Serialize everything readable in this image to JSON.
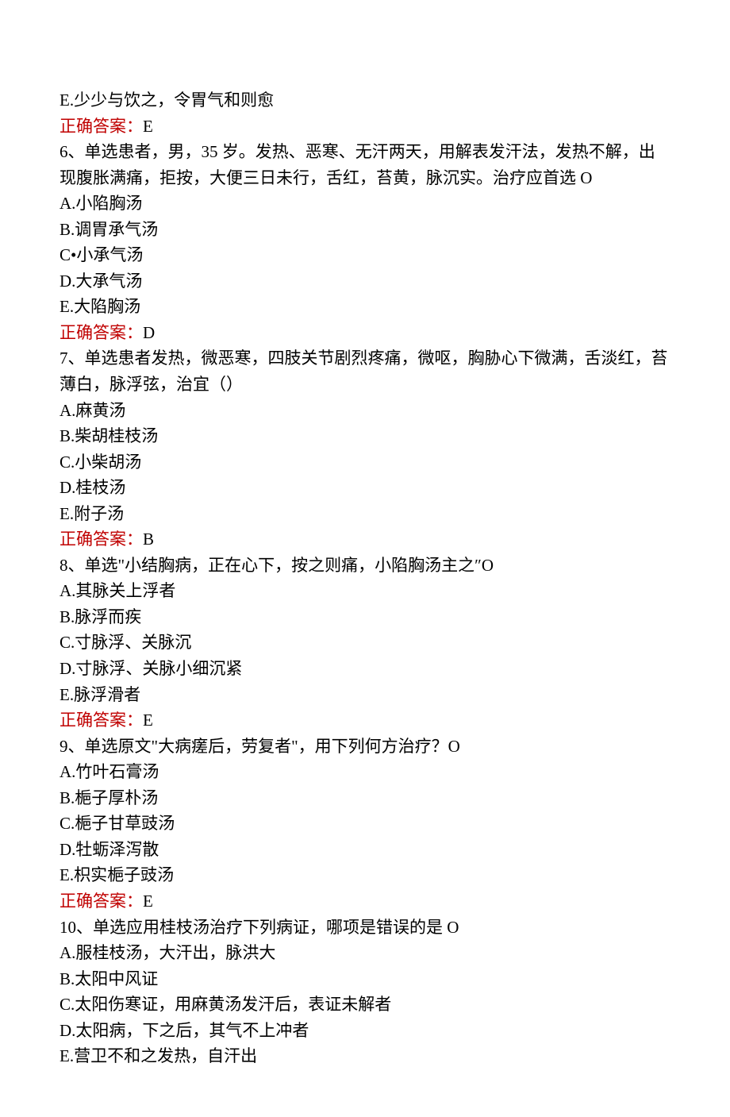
{
  "q5": {
    "optionE": "E.少少与饮之，令胃气和则愈",
    "answerLabel": "正确答案：",
    "answerValue": "E"
  },
  "q6": {
    "stem": "6、单选患者，男，35 岁。发热、恶寒、无汗两天，用解表发汗法，发热不解，出现腹胀满痛，拒按，大便三日未行，舌红，苔黄，脉沉实。治疗应首选 O",
    "A": "A.小陷胸汤",
    "B": "B.调胃承气汤",
    "C": "C•小承气汤",
    "D": "D.大承气汤",
    "E": "E.大陷胸汤",
    "answerLabel": "正确答案：",
    "answerValue": "D"
  },
  "q7": {
    "stem": "7、单选患者发热，微恶寒，四肢关节剧烈疼痛，微呕，胸胁心下微满，舌淡红，苔薄白，脉浮弦，治宜（）",
    "A": "A.麻黄汤",
    "B": "B.柴胡桂枝汤",
    "C": "C.小柴胡汤",
    "D": "D.桂枝汤",
    "E": "E.附子汤",
    "answerLabel": "正确答案：",
    "answerValue": "B"
  },
  "q8": {
    "stem": "8、单选\"小结胸病，正在心下，按之则痛，小陷胸汤主之″O",
    "A": "A.其脉关上浮者",
    "B": "B.脉浮而疾",
    "C": "C.寸脉浮、关脉沉",
    "D": "D.寸脉浮、关脉小细沉紧",
    "E": "E.脉浮滑者",
    "answerLabel": "正确答案：",
    "answerValue": "E"
  },
  "q9": {
    "stem": "9、单选原文\"大病瘥后，劳复者\"，用下列何方治疗？O",
    "A": "A.竹叶石膏汤",
    "B": "B.梔子厚朴汤",
    "C": "C.梔子甘草豉汤",
    "D": "D.牡蛎泽泻散",
    "E": "E.枳实梔子豉汤",
    "answerLabel": "正确答案：",
    "answerValue": "E"
  },
  "q10": {
    "stem": "10、单选应用桂枝汤治疗下列病证，哪项是错误的是 O",
    "A": "A.服桂枝汤，大汗出，脉洪大",
    "B": "B.太阳中风证",
    "C": "C.太阳伤寒证，用麻黄汤发汗后，表证未解者",
    "D": "D.太阳病，下之后，其气不上冲者",
    "E": "E.营卫不和之发热，自汗出"
  }
}
